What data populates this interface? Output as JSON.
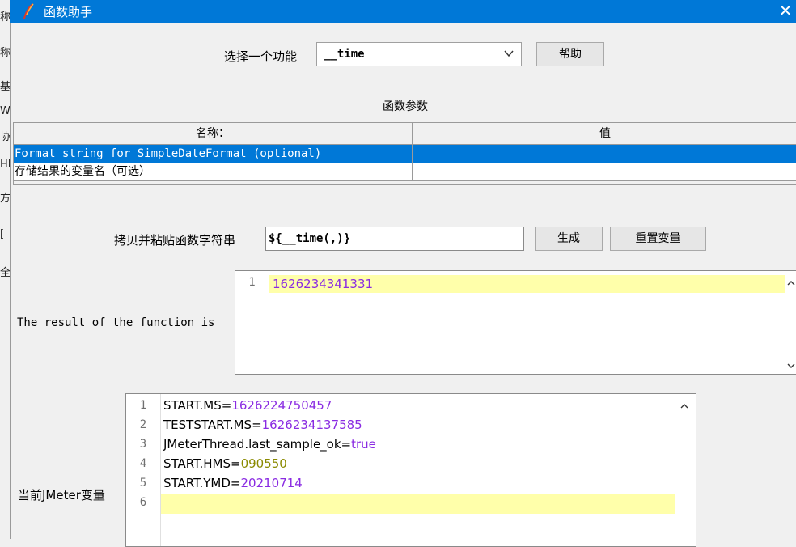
{
  "background_window": {
    "fragments": [
      "称",
      "称",
      "基",
      "We",
      "协",
      "HI",
      "方",
      "[",
      "全"
    ]
  },
  "window": {
    "title": "函数助手",
    "close_glyph": "✕",
    "icon": "feather-icon"
  },
  "function_select": {
    "label": "选择一个功能",
    "value": "__time",
    "help_button": "帮助"
  },
  "params": {
    "section_title": "函数参数",
    "columns": [
      "名称：",
      "值"
    ],
    "rows": [
      {
        "name": "Format string for SimpleDateFormat (optional)",
        "value": "",
        "selected": true
      },
      {
        "name": "存储结果的变量名（可选）",
        "value": "",
        "selected": false
      }
    ]
  },
  "function_string": {
    "label": "拷贝并粘贴函数字符串",
    "value": "${__time(,)}",
    "generate_button": "生成",
    "reset_button": "重置变量"
  },
  "result": {
    "label": "The result of the function is",
    "lines": [
      {
        "num": "1",
        "text": "1626234341331"
      }
    ]
  },
  "variables": {
    "label": "当前JMeter变量",
    "lines": [
      {
        "num": "1",
        "key": "START.MS",
        "value": "1626224750457"
      },
      {
        "num": "2",
        "key": "TESTSTART.MS",
        "value": "1626234137585"
      },
      {
        "num": "3",
        "key": "JMeterThread.last_sample_ok",
        "value": "true"
      },
      {
        "num": "4",
        "key": "START.HMS",
        "value": "090550"
      },
      {
        "num": "5",
        "key": "START.YMD",
        "value": "20210714"
      },
      {
        "num": "6",
        "key": "",
        "value": ""
      }
    ]
  },
  "colors": {
    "titlebar": "#0078d7",
    "selection": "#0078d7",
    "current_line": "#ffffaa",
    "number_value": "#8a2be2"
  }
}
